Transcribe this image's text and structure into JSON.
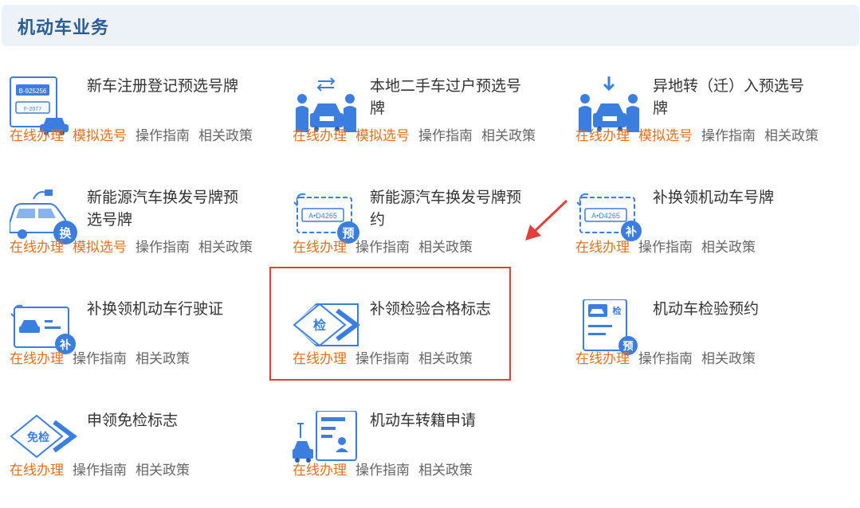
{
  "section": {
    "title": "机动车业务"
  },
  "colors": {
    "accent": "#e5701f",
    "brand": "#2b5c94",
    "icon_blue": "#3c7ee0",
    "highlight": "#e2403b"
  },
  "services": [
    {
      "title": "新车注册登记预选号牌",
      "icon": "license-plate-car-icon",
      "links": [
        {
          "label": "在线办理",
          "kind": "primary"
        },
        {
          "label": "模拟选号",
          "kind": "primary"
        },
        {
          "label": "操作指南",
          "kind": "secondary"
        },
        {
          "label": "相关政策",
          "kind": "secondary"
        }
      ]
    },
    {
      "title": "本地二手车过户预选号牌",
      "icon": "car-transfer-icon",
      "links": [
        {
          "label": "在线办理",
          "kind": "primary"
        },
        {
          "label": "模拟选号",
          "kind": "primary"
        },
        {
          "label": "操作指南",
          "kind": "secondary"
        },
        {
          "label": "相关政策",
          "kind": "secondary"
        }
      ]
    },
    {
      "title": "异地转（迁）入预选号牌",
      "icon": "car-move-in-icon",
      "links": [
        {
          "label": "在线办理",
          "kind": "primary"
        },
        {
          "label": "模拟选号",
          "kind": "primary"
        },
        {
          "label": "操作指南",
          "kind": "secondary"
        },
        {
          "label": "相关政策",
          "kind": "secondary"
        }
      ]
    },
    {
      "title": "新能源汽车换发号牌预选号牌",
      "icon": "ev-plate-change-icon",
      "links": [
        {
          "label": "在线办理",
          "kind": "primary"
        },
        {
          "label": "模拟选号",
          "kind": "primary"
        },
        {
          "label": "操作指南",
          "kind": "secondary"
        },
        {
          "label": "相关政策",
          "kind": "secondary"
        }
      ]
    },
    {
      "title": "新能源汽车换发号牌预约",
      "icon": "ev-plate-appointment-icon",
      "links": [
        {
          "label": "在线办理",
          "kind": "primary"
        },
        {
          "label": "操作指南",
          "kind": "secondary"
        },
        {
          "label": "相关政策",
          "kind": "secondary"
        }
      ]
    },
    {
      "title": "补换领机动车号牌",
      "icon": "plate-replace-icon",
      "links": [
        {
          "label": "在线办理",
          "kind": "primary"
        },
        {
          "label": "操作指南",
          "kind": "secondary"
        },
        {
          "label": "相关政策",
          "kind": "secondary"
        }
      ]
    },
    {
      "title": "补换领机动车行驶证",
      "icon": "driving-license-replace-icon",
      "links": [
        {
          "label": "在线办理",
          "kind": "primary"
        },
        {
          "label": "操作指南",
          "kind": "secondary"
        },
        {
          "label": "相关政策",
          "kind": "secondary"
        }
      ]
    },
    {
      "title": "补领检验合格标志",
      "icon": "inspection-sticker-icon",
      "links": [
        {
          "label": "在线办理",
          "kind": "primary"
        },
        {
          "label": "操作指南",
          "kind": "secondary"
        },
        {
          "label": "相关政策",
          "kind": "secondary"
        }
      ]
    },
    {
      "title": "机动车检验预约",
      "icon": "inspection-appointment-icon",
      "links": [
        {
          "label": "在线办理",
          "kind": "primary"
        },
        {
          "label": "操作指南",
          "kind": "secondary"
        },
        {
          "label": "相关政策",
          "kind": "secondary"
        }
      ]
    },
    {
      "title": "申领免检标志",
      "icon": "exemption-sticker-icon",
      "links": [
        {
          "label": "在线办理",
          "kind": "primary"
        },
        {
          "label": "操作指南",
          "kind": "secondary"
        },
        {
          "label": "相关政策",
          "kind": "secondary"
        }
      ]
    },
    {
      "title": "机动车转籍申请",
      "icon": "vehicle-transfer-registration-icon",
      "links": [
        {
          "label": "在线办理",
          "kind": "primary"
        },
        {
          "label": "操作指南",
          "kind": "secondary"
        },
        {
          "label": "相关政策",
          "kind": "secondary"
        }
      ]
    }
  ],
  "icon_text": {
    "plate_top": "B-925256",
    "plate_bottom": "F-2077",
    "plate_number": "A•D4265",
    "badge_change": "换",
    "badge_reserve": "预",
    "badge_replace": "补",
    "badge_inspect": "检",
    "badge_exempt": "免检"
  }
}
